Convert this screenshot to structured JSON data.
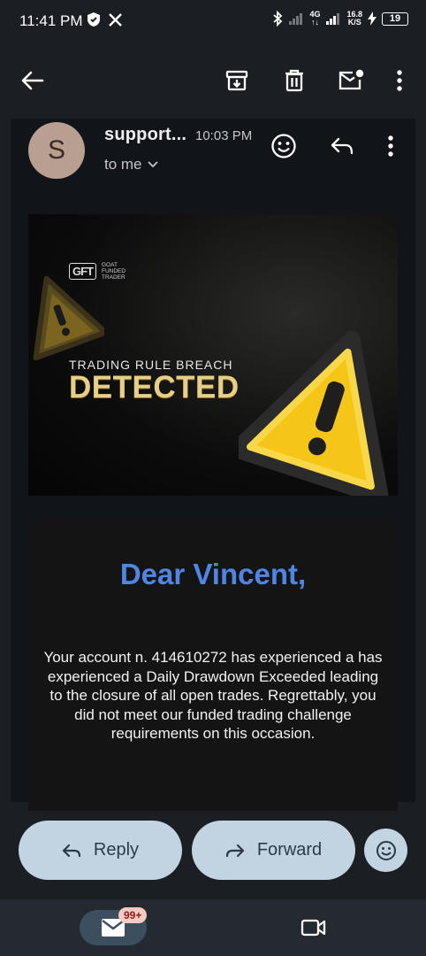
{
  "status_bar": {
    "time": "11:41 PM",
    "network_top": "4G",
    "speed_value": "16.8",
    "speed_unit": "K/S",
    "battery": "19"
  },
  "email": {
    "avatar_letter": "S",
    "sender": "support...",
    "time": "10:03 PM",
    "recipient": "to me"
  },
  "banner": {
    "brand_logo": "GFT",
    "brand_line1": "GOAT",
    "brand_line2": "FUNDED",
    "brand_line3": "TRADER",
    "subtitle": "TRADING RULE BREACH",
    "title": "DETECTED"
  },
  "card": {
    "greeting": "Dear Vincent,",
    "message": "Your account n. 414610272 has experienced a has experienced a Daily Drawdown Exceeded leading to the closure of all open trades. Regrettably, you did not meet our funded trading challenge requirements on this occasion."
  },
  "actions": {
    "reply": "Reply",
    "forward": "Forward"
  },
  "bottom_nav": {
    "badge": "99+"
  },
  "colors": {
    "accent": "#4f86e6",
    "button_bg": "#c2d4e2",
    "gold": "#e7cf86",
    "warning_yellow": "#f5c518"
  }
}
